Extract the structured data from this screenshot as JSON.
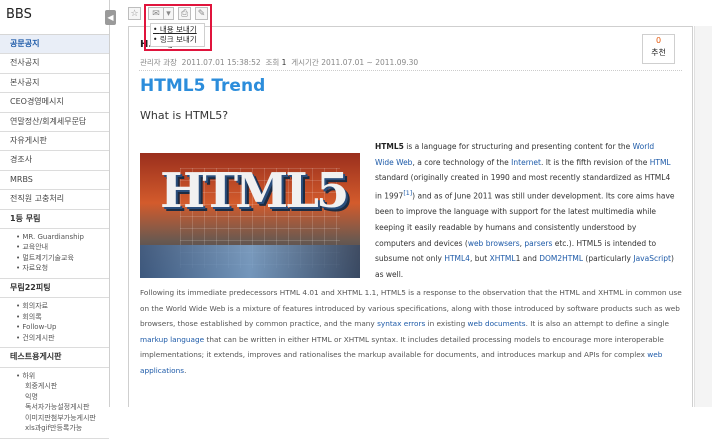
{
  "sidebar": {
    "title": "BBS",
    "collapse_icon": "◀",
    "menu": [
      {
        "label": "공문공지",
        "active": true
      },
      {
        "label": "전사공지"
      },
      {
        "label": "본사공지"
      },
      {
        "label": "CEO경영메시지"
      },
      {
        "label": "연말정산/회계세무문답"
      },
      {
        "label": "자유게시판"
      },
      {
        "label": "경조사"
      },
      {
        "label": "MRBS"
      },
      {
        "label": "전직원 고충처리"
      }
    ],
    "groups": [
      {
        "label": "1등 무림",
        "items": [
          "MR. Guardianship",
          "교육안내",
          "멀트제기기술교육",
          "자료요청"
        ]
      },
      {
        "label": "무림22피팅",
        "items": [
          "회의자료",
          "회의록",
          "Follow-Up",
          "건의게시판"
        ]
      },
      {
        "label": "테스트용게시판",
        "items": [
          "하위",
          "회중게시판",
          "익명",
          "독서자가능설정게시판",
          "이미지판첨부가능게시판",
          "xls과gif만등록가능"
        ]
      }
    ]
  },
  "toolbar": {
    "icons": [
      "☆",
      "✉",
      "▾",
      "⎙",
      "✎"
    ]
  },
  "send_menu": {
    "items": [
      "내용 보내기",
      "링크 보내기"
    ]
  },
  "post": {
    "title": "H... 재",
    "meta_author": "관리자 과장",
    "meta_date": "2011.07.01 15:38:52",
    "meta_views_label": "조회",
    "meta_views": "1",
    "meta_period_label": "게시기간",
    "meta_period": "2011.07.01 ~ 2011.09.30",
    "recommend_count": "0",
    "recommend_label": "추천",
    "heading": "HTML5 Trend",
    "subheading": "What is HTML5?",
    "image_text": "HTML5",
    "right_para": {
      "t1": "HTML5",
      "t2": " is a language for structuring and presenting content for the ",
      "l1": "World Wide Web",
      "t3": ", a core technology of the ",
      "l2": "Internet",
      "t4": ". It is the fifth revision of the ",
      "l3": "HTML",
      "t5": " standard (originally created in 1990 and most recently standardized as HTML4 in 1997",
      "l4": "[1]",
      "t6": ") and as of June 2011 was still under development. Its core aims have been to improve the language with support for the latest multimedia while keeping it easily readable by humans and consistently understood by computers and devices (",
      "l5": "web browsers",
      "t7": ", ",
      "l6": "parsers",
      "t8": " etc.). HTML5 is intended to subsume not only ",
      "l7": "HTML4",
      "t9": ", but ",
      "l8": "XHTML",
      "t10": "1 and ",
      "l9": "DOM2HTML",
      "t11": " (particularly ",
      "l10": "JavaScript",
      "t12": ") as well."
    },
    "lower_para": {
      "t1": "Following its immediate predecessors HTML 4.01 and XHTML 1.1, HTML5 is a response to the observation that the HTML and XHTML in common use on the World Wide Web is a mixture of features introduced by various specifications, along with those introduced by software products such as web browsers, those established by common practice, and the many ",
      "l1": "syntax errors",
      "t2": " in existing ",
      "l2": "web documents",
      "t3": ". It is also an attempt to define a single ",
      "l3": "markup language",
      "t4": " that can be written in either HTML or XHTML syntax. It includes detailed processing models to encourage more interoperable implementations; it extends, improves and rationalises the markup available for documents, and introduces markup and APIs for complex ",
      "l4": "web applications",
      "t5": "."
    }
  }
}
